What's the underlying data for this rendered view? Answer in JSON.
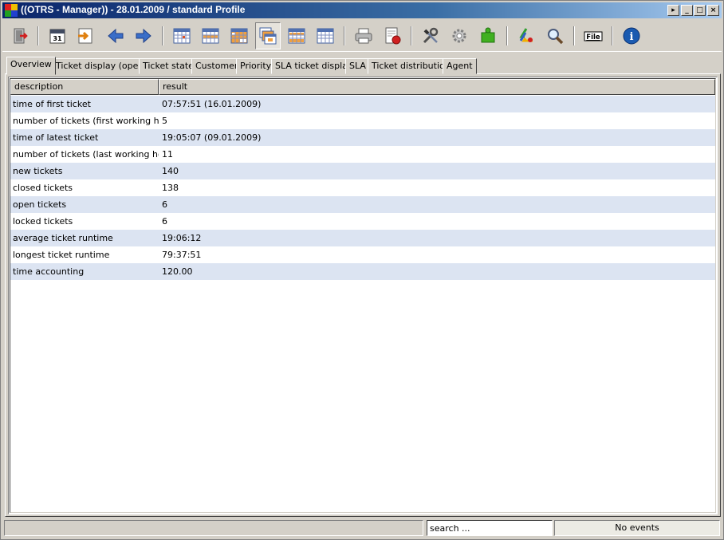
{
  "window": {
    "title": "((OTRS - Manager)) - 28.01.2009 / standard Profile",
    "controls": {
      "extra": "▸",
      "minimize": "_",
      "maximize": "□",
      "close": "×"
    }
  },
  "toolbar": {
    "items": [
      {
        "name": "exit-icon"
      },
      {
        "name": "calendar-icon",
        "label": "31"
      },
      {
        "name": "import-icon"
      },
      {
        "name": "back-arrow-icon"
      },
      {
        "name": "forward-arrow-icon"
      },
      {
        "name": "grid-view-1-icon"
      },
      {
        "name": "grid-view-2-icon"
      },
      {
        "name": "grid-view-3-icon"
      },
      {
        "name": "multi-grid-view-icon"
      },
      {
        "name": "grid-view-4-icon"
      },
      {
        "name": "grid-view-5-icon"
      },
      {
        "name": "printer-icon"
      },
      {
        "name": "print-preview-icon"
      },
      {
        "name": "tools-icon"
      },
      {
        "name": "settings-gear-icon"
      },
      {
        "name": "plugin-puzzle-icon"
      },
      {
        "name": "recycle-icon"
      },
      {
        "name": "search-magnifier-icon"
      },
      {
        "name": "file-menu-icon",
        "label": "File"
      },
      {
        "name": "info-icon",
        "label": "i"
      }
    ]
  },
  "tabs": [
    {
      "label": "Overview",
      "active": true
    },
    {
      "label": "Ticket display (open)"
    },
    {
      "label": "Ticket state"
    },
    {
      "label": "Customer"
    },
    {
      "label": "Priority"
    },
    {
      "label": "SLA ticket display"
    },
    {
      "label": "SLA"
    },
    {
      "label": "Ticket distribution"
    },
    {
      "label": "Agent"
    }
  ],
  "table": {
    "columns": [
      "description",
      "result"
    ],
    "rows": [
      [
        "time of first ticket",
        "07:57:51 (16.01.2009)"
      ],
      [
        "number of tickets (first working hour)",
        "5"
      ],
      [
        "time of latest ticket",
        "19:05:07 (09.01.2009)"
      ],
      [
        "number of tickets (last working hour)",
        "11"
      ],
      [
        "new tickets",
        "140"
      ],
      [
        "closed tickets",
        "138"
      ],
      [
        "open tickets",
        "6"
      ],
      [
        "locked tickets",
        "6"
      ],
      [
        "average ticket runtime",
        "19:06:12"
      ],
      [
        "longest ticket runtime",
        "79:37:51"
      ],
      [
        "time accounting",
        "120.00"
      ]
    ]
  },
  "statusbar": {
    "search_placeholder": "search ...",
    "events_text": "No events"
  }
}
